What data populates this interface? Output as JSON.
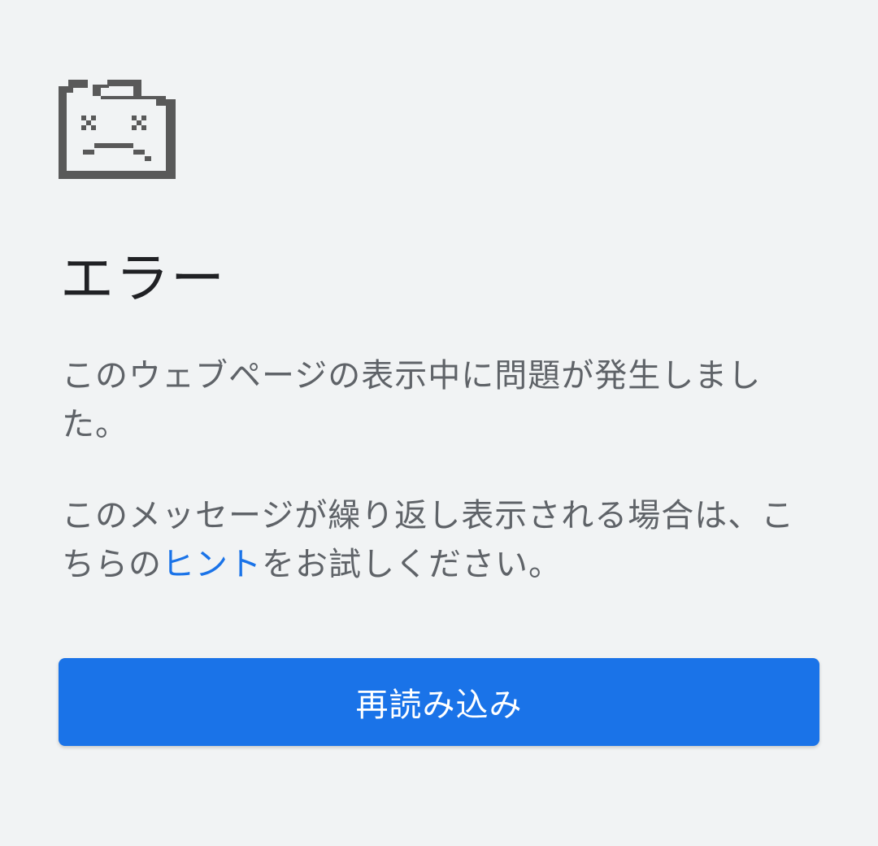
{
  "error_page": {
    "icon": "sad-tab-icon",
    "title": "エラー",
    "message": "このウェブページの表示中に問題が発生しました。",
    "suggestion_prefix": "このメッセージが繰り返し表示される場合は、こちらの",
    "hint_link_label": "ヒント",
    "suggestion_suffix": "をお試しください。",
    "reload_label": "再読み込み"
  },
  "colors": {
    "background": "#f1f3f4",
    "title_text": "#202124",
    "body_text": "#5f6368",
    "link": "#1a73e8",
    "button": "#1a73e8",
    "icon": "#595959"
  }
}
